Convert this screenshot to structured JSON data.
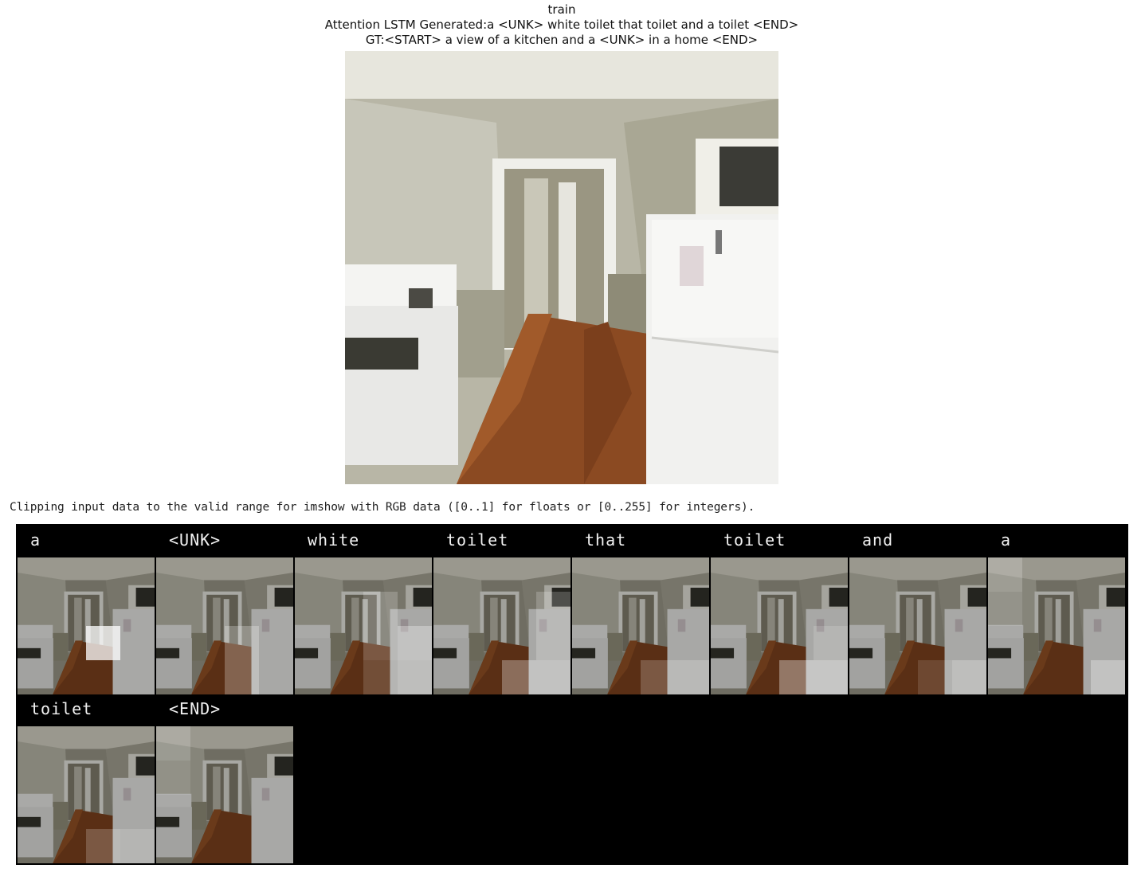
{
  "figure": {
    "title": "train",
    "generated_caption": "Attention LSTM Generated:a <UNK> white toilet that toilet and a toilet <END>",
    "gt_caption": "GT:<START> a view of a kitchen and a <UNK> in a home <END>"
  },
  "console": {
    "warning": "Clipping input data to the valid range for imshow with RGB data ([0..1] for floats or [0..255] for integers)."
  },
  "attention_grid": {
    "words": [
      "a",
      "<UNK>",
      "white",
      "toilet",
      "that",
      "toilet",
      "and",
      "a",
      "toilet",
      "<END>"
    ]
  }
}
